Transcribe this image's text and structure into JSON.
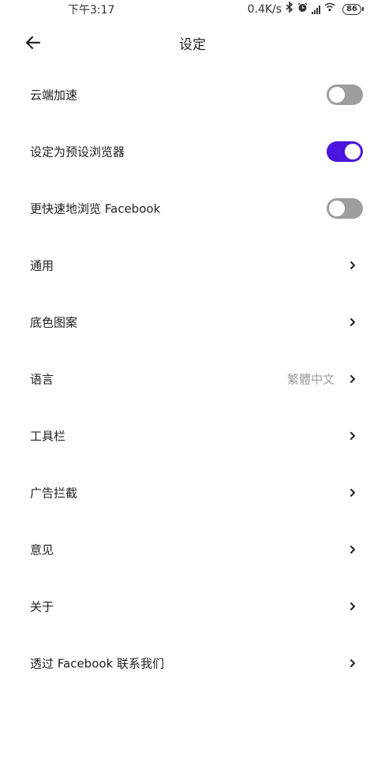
{
  "status_bar": {
    "time": "下午3:17",
    "network_speed": "0.4K/s",
    "battery_level": "86",
    "icons": [
      "bluetooth-icon",
      "alarm-icon",
      "signal-icon",
      "wifi-icon",
      "battery-icon"
    ]
  },
  "header": {
    "title": "设定",
    "back_icon": "arrow-left-icon"
  },
  "accent_color": "#4a16e0",
  "settings": {
    "items": [
      {
        "label": "云端加速",
        "type": "toggle",
        "checked": false
      },
      {
        "label": "设定为预设浏览器",
        "type": "toggle",
        "checked": true
      },
      {
        "label": "更快速地浏览 Facebook",
        "type": "toggle",
        "checked": false
      },
      {
        "label": "通用",
        "type": "link"
      },
      {
        "label": "底色图案",
        "type": "link"
      },
      {
        "label": "语言",
        "type": "link",
        "value": "繁體中文"
      },
      {
        "label": "工具栏",
        "type": "link"
      },
      {
        "label": "广告拦截",
        "type": "link"
      },
      {
        "label": "意见",
        "type": "link"
      },
      {
        "label": "关于",
        "type": "link"
      },
      {
        "label": "透过 Facebook 联系我们",
        "type": "link"
      }
    ]
  }
}
